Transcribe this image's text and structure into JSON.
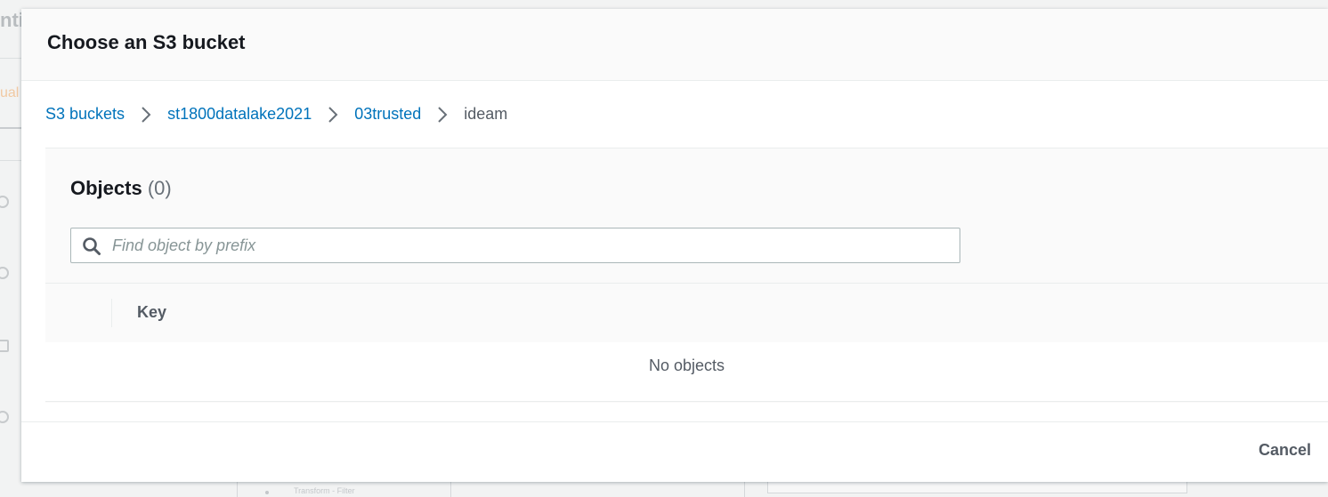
{
  "background": {
    "title_fragment": "nti",
    "tab_fragment": "ual",
    "node_label": "Transform - Filter"
  },
  "modal": {
    "title": "Choose an S3 bucket",
    "breadcrumb": [
      {
        "label": "S3 buckets",
        "link": true
      },
      {
        "label": "st1800datalake2021",
        "link": true
      },
      {
        "label": "03trusted",
        "link": true
      },
      {
        "label": "ideam",
        "link": false
      }
    ],
    "objects": {
      "heading": "Objects",
      "count": "(0)",
      "search": {
        "placeholder": "Find object by prefix",
        "value": ""
      },
      "columns": [
        "Key"
      ],
      "empty_message": "No objects"
    },
    "footer": {
      "cancel_label": "Cancel"
    }
  },
  "colors": {
    "link": "#0073bb",
    "text": "#16191f",
    "muted": "#545b64",
    "border": "#eaeded"
  }
}
